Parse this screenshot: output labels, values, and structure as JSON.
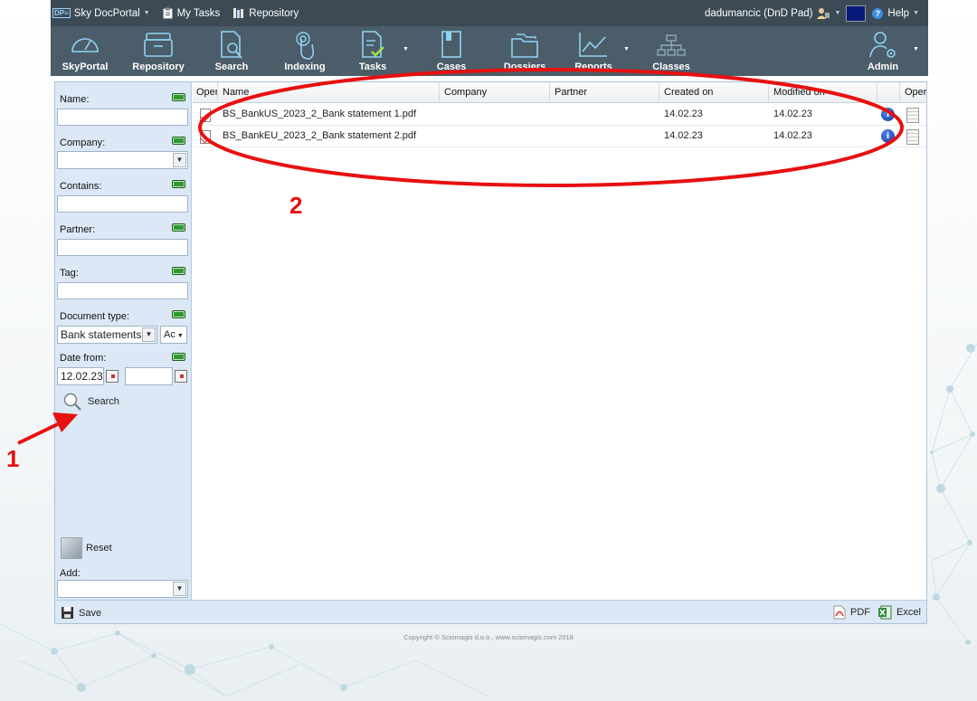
{
  "topbar": {
    "logo": "DP≡",
    "app_name": "Sky DocPortal",
    "my_tasks": "My Tasks",
    "repository": "Repository",
    "user": "dadumancic (DnD Pad)",
    "help": "Help"
  },
  "toolbar": {
    "items": [
      {
        "label": "SkyPortal",
        "icon": "gauge-icon"
      },
      {
        "label": "Repository",
        "icon": "archive-icon"
      },
      {
        "label": "Search",
        "icon": "search-doc-icon"
      },
      {
        "label": "Indexing",
        "icon": "touch-icon"
      },
      {
        "label": "Tasks",
        "icon": "task-check-icon"
      },
      {
        "label": "Cases",
        "icon": "book-icon"
      },
      {
        "label": "Dossiers",
        "icon": "folders-icon"
      },
      {
        "label": "Reports",
        "icon": "chart-icon"
      },
      {
        "label": "Classes",
        "icon": "hierarchy-icon"
      },
      {
        "label": "Admin",
        "icon": "admin-icon"
      }
    ]
  },
  "filters": {
    "name_label": "Name:",
    "company_label": "Company:",
    "contains_label": "Contains:",
    "partner_label": "Partner:",
    "tag_label": "Tag:",
    "doctype_label": "Document type:",
    "doctype_value": "Bank statements",
    "doctype_extra": "Ac",
    "date_from_label": "Date from:",
    "date_from_value": "12.02.23",
    "search_label": "Search",
    "reset_label": "Reset",
    "add_label": "Add:"
  },
  "grid": {
    "columns": [
      "Oper",
      "Name",
      "Company",
      "Partner",
      "Created on",
      "Modified on",
      "",
      "Oper"
    ],
    "rows": [
      {
        "name": "BS_BankUS_2023_2_Bank statement 1.pdf",
        "company": "",
        "partner": "",
        "created": "14.02.23",
        "modified": "14.02.23"
      },
      {
        "name": "BS_BankEU_2023_2_Bank statement 2.pdf",
        "company": "",
        "partner": "",
        "created": "14.02.23",
        "modified": "14.02.23"
      }
    ]
  },
  "bottombar": {
    "save": "Save",
    "pdf": "PDF",
    "excel": "Excel"
  },
  "copyright": "Copyright © Sciomagis d.o.o., www.sciomagis.com 2018",
  "annotations": {
    "marker_1": "1",
    "marker_2": "2",
    "color": "#e81010"
  }
}
